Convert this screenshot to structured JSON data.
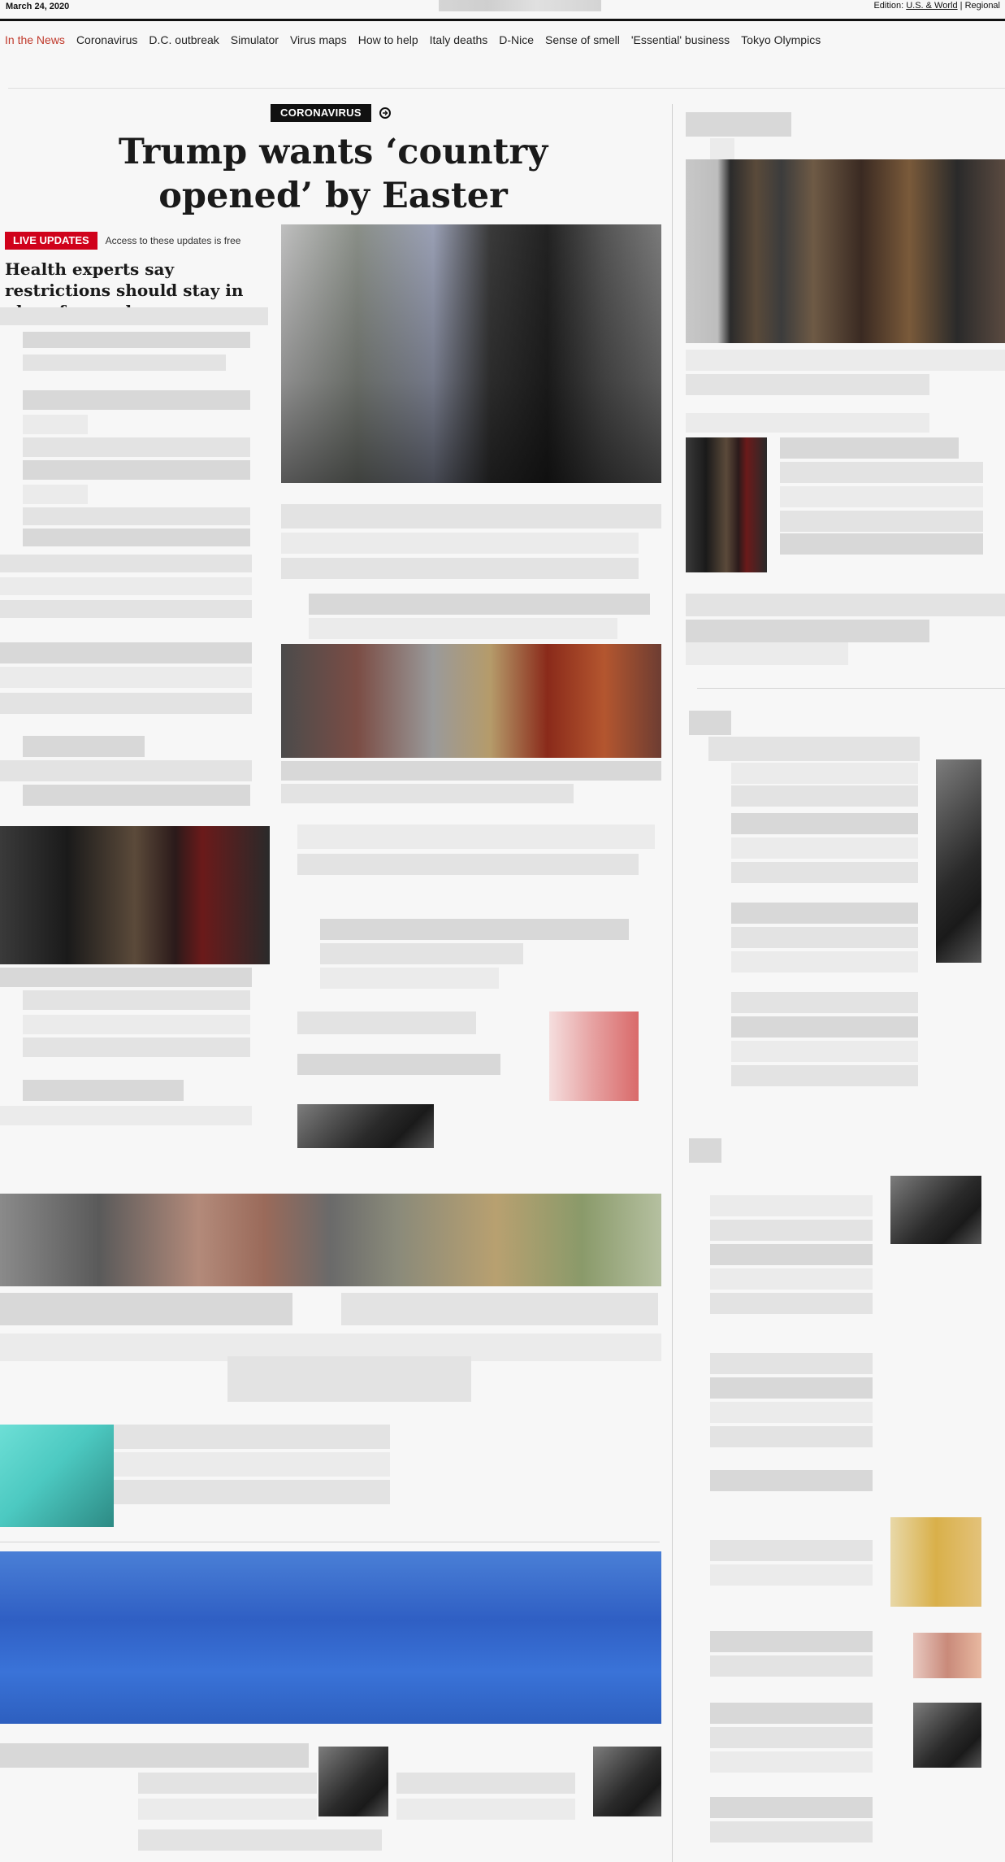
{
  "topbar": {
    "date": "March 24, 2020",
    "edition_label": "Edition:",
    "edition_world": "U.S. & World",
    "edition_separator": "|",
    "edition_regional": "Regional"
  },
  "nav": {
    "lead": "In the News",
    "items": [
      "Coronavirus",
      "D.C. outbreak",
      "Simulator",
      "Virus maps",
      "How to help",
      "Italy deaths",
      "D-Nice",
      "Sense of smell",
      "'Essential' business",
      "Tokyo Olympics"
    ]
  },
  "main": {
    "kicker": "CORONAVIRUS",
    "headline": "Trump wants ‘country opened’ by Easter",
    "live_badge": "LIVE UPDATES",
    "free_note": "Access to these updates is free",
    "subhead": "Health experts say restrictions should stay in place for weeks"
  },
  "colors": {
    "accent_red": "#d0021b",
    "nav_lead_red": "#c0392b",
    "ink": "#111111",
    "background": "#f7f7f7"
  },
  "icons": {
    "kicker_arrow": "arrow-right-circle-icon"
  }
}
